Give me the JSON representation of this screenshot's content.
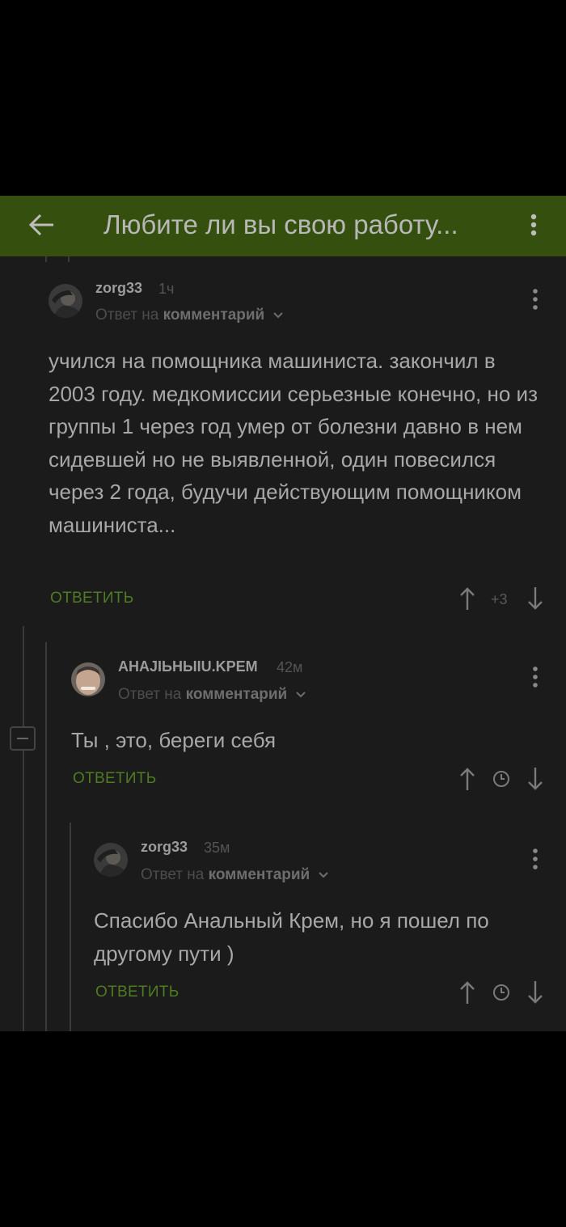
{
  "header": {
    "title": "Любите ли вы свою работу..."
  },
  "comments": [
    {
      "username": "zorg33",
      "time": "1ч",
      "reply_prefix": "Ответ на",
      "reply_target": "комментарий",
      "text": "учился на помощника машиниста. закончил в 2003 году. медкомиссии серьезные конечно, но из группы 1 через год умер от болезни давно в нем сидевшей но не выявленной, один повесился через 2 года, будучи действующим помощником машиниста...",
      "reply_label": "ОТВЕТИТЬ",
      "rating": "+3"
    },
    {
      "username": "АНАЈIЬНЫIU.KPEM",
      "time": "42м",
      "reply_prefix": "Ответ на",
      "reply_target": "комментарий",
      "text": "Ты , это, береги себя",
      "reply_label": "ОТВЕТИТЬ"
    },
    {
      "username": "zorg33",
      "time": "35м",
      "reply_prefix": "Ответ на",
      "reply_target": "комментарий",
      "text": "Спасибо Анальный Крем, но я пошел по другому пути )",
      "reply_label": "ОТВЕТИТЬ"
    }
  ],
  "icons": {
    "back": "arrow-left-icon",
    "menu": "more-vertical-icon",
    "up": "arrow-up-icon",
    "down": "arrow-down-icon",
    "clock": "clock-icon",
    "chevron": "chevron-down-icon",
    "collapse": "collapse-thread-icon"
  },
  "colors": {
    "header_bg": "#35500e",
    "background": "#1b1b1b",
    "reply_green": "#4f7b23"
  }
}
